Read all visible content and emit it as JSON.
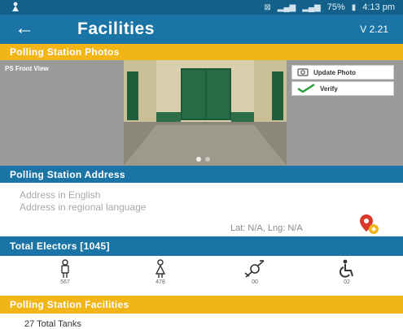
{
  "status_bar": {
    "battery": "75%",
    "time": "4:13 pm"
  },
  "app_bar": {
    "title": "Facilities",
    "version": "V 2.21"
  },
  "photos_section": {
    "header": "Polling Station Photos",
    "photo_caption": "PS Front View",
    "update_photo_label": "Update Photo",
    "verify_label": "Verify"
  },
  "address_section": {
    "header": "Polling Station Address",
    "address_english_placeholder": "Address in English",
    "address_regional_placeholder": "Address in regional language",
    "lat_lng": "Lat: N/A, Lng: N/A"
  },
  "electors_section": {
    "header": "Total Electors [1045]",
    "counts": {
      "male": "567",
      "female": "478",
      "third_gender": "00",
      "pwd": "02"
    }
  },
  "facilities_section": {
    "header": "Polling Station Facilities",
    "first_row": "27 Total Tanks"
  },
  "colors": {
    "primary": "#1a74a5",
    "status": "#13608b",
    "accent": "#f2b516"
  }
}
